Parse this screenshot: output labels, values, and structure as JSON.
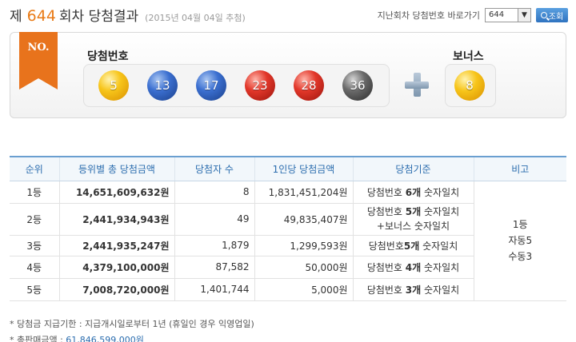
{
  "header": {
    "title_prefix": "제",
    "round": "644",
    "title_suffix": "회차 당첨결과",
    "draw_date": "(2015년 04월 04일 추첨)",
    "prev_label": "지난회차 당첨번호 바로가기",
    "prev_select_value": "644",
    "search_label": "조회"
  },
  "panel": {
    "ribbon": "NO.",
    "main_label": "당첨번호",
    "bonus_label": "보너스",
    "numbers": [
      "5",
      "13",
      "17",
      "23",
      "28",
      "36"
    ],
    "bonus_number": "8",
    "ball_colors": {
      "yellow": "#f7c51a",
      "blue": "#3b6fd0",
      "red": "#e2372a",
      "gray": "#6a6a6a"
    }
  },
  "table": {
    "headers": [
      "순위",
      "등위별 총 당첨금액",
      "당첨자 수",
      "1인당 당첨금액",
      "당첨기준",
      "비고"
    ],
    "rows": [
      {
        "rank": "1등",
        "total": "14,651,609,632원",
        "count": "8",
        "each": "1,831,451,204원",
        "crit_a": "당첨번호 ",
        "crit_b": "6개",
        "crit_c": " 숫자일치"
      },
      {
        "rank": "2등",
        "total": "2,441,934,943원",
        "count": "49",
        "each": "49,835,407원",
        "crit_a": "당첨번호 ",
        "crit_b": "5개",
        "crit_c": " 숫자일치",
        "crit_line2": "+보너스 숫자일치"
      },
      {
        "rank": "3등",
        "total": "2,441,935,247원",
        "count": "1,879",
        "each": "1,299,593원",
        "crit_a": "당첨번호",
        "crit_b": "5개",
        "crit_c": " 숫자일치"
      },
      {
        "rank": "4등",
        "total": "4,379,100,000원",
        "count": "87,582",
        "each": "50,000원",
        "crit_a": "당첨번호 ",
        "crit_b": "4개",
        "crit_c": " 숫자일치"
      },
      {
        "rank": "5등",
        "total": "7,008,720,000원",
        "count": "1,401,744",
        "each": "5,000원",
        "crit_a": "당첨번호 ",
        "crit_b": "3개",
        "crit_c": " 숫자일치"
      }
    ],
    "note_lines": [
      "1등",
      "자동5",
      "수동3"
    ]
  },
  "notes": {
    "deadline": "* 당첨금 지급기한 : 지급개시일로부터 1년 (휴일인 경우 익영업일)",
    "sales_label": "* 총판매금액 : ",
    "sales_value": "61,846,599,000원"
  }
}
